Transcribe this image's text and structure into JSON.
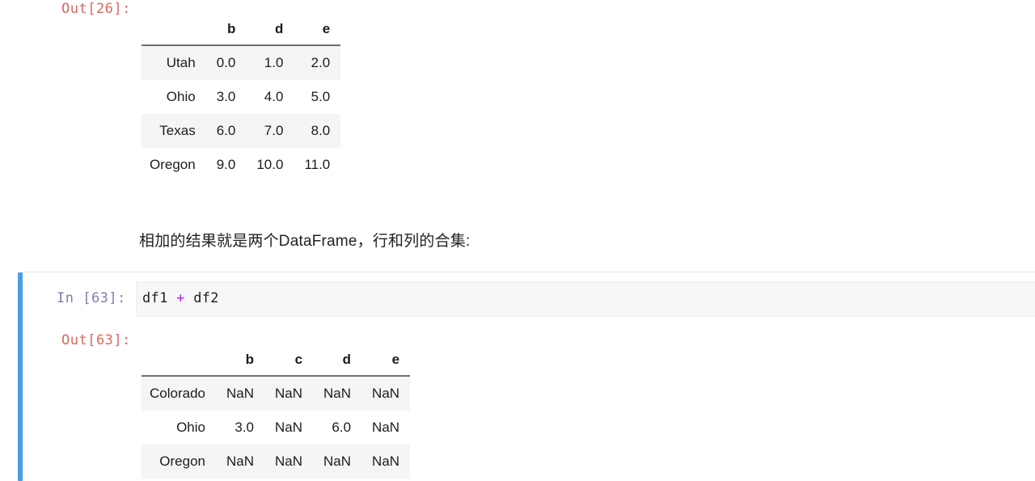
{
  "notebook": {
    "background_color": "#ffffff",
    "selection_bar_color": "#4a9de8",
    "out_prompt_color": "#d9695f",
    "in_prompt_color": "#7b7fb0",
    "code_background_color": "#f7f7f7",
    "operator_color": "#aa22ff",
    "row_stripe_color": "#f5f5f5",
    "header_rule_color": "#6f6f6f"
  },
  "cells": {
    "output_26": {
      "prompt": "Out[26]:",
      "table": {
        "corner_label": "",
        "columns": [
          "b",
          "d",
          "e"
        ],
        "index": [
          "Utah",
          "Ohio",
          "Texas",
          "Oregon"
        ],
        "rows": [
          [
            "0.0",
            "1.0",
            "2.0"
          ],
          [
            "3.0",
            "4.0",
            "5.0"
          ],
          [
            "6.0",
            "7.0",
            "8.0"
          ],
          [
            "9.0",
            "10.0",
            "11.0"
          ]
        ]
      }
    },
    "markdown": {
      "text": "相加的结果就是两个DataFrame，行和列的合集:"
    },
    "input_63": {
      "prompt": "In [63]:",
      "code_prefix": "df1 ",
      "code_operator": "+",
      "code_suffix": " df2"
    },
    "output_63": {
      "prompt": "Out[63]:",
      "table": {
        "corner_label": "",
        "columns": [
          "b",
          "c",
          "d",
          "e"
        ],
        "index": [
          "Colorado",
          "Ohio",
          "Oregon"
        ],
        "rows": [
          [
            "NaN",
            "NaN",
            "NaN",
            "NaN"
          ],
          [
            "3.0",
            "NaN",
            "6.0",
            "NaN"
          ],
          [
            "NaN",
            "NaN",
            "NaN",
            "NaN"
          ]
        ]
      }
    }
  }
}
